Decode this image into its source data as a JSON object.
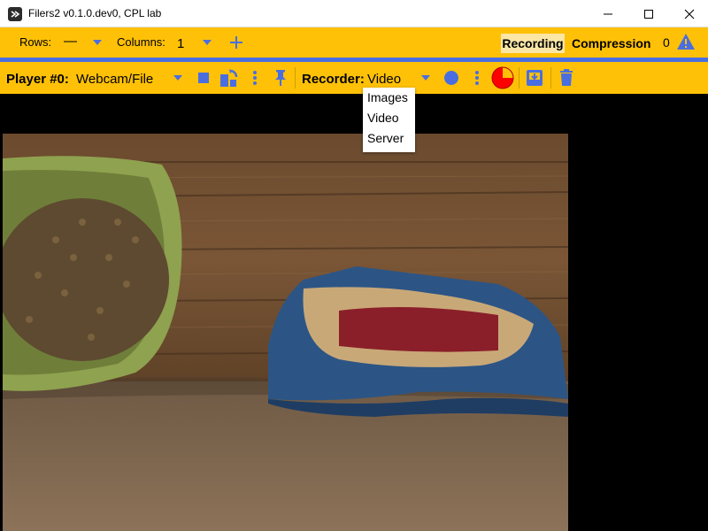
{
  "window": {
    "title": "Filers2 v0.1.0.dev0, CPL lab"
  },
  "top_toolbar": {
    "rows_label": "Rows:",
    "rows_value": "—",
    "columns_label": "Columns:",
    "columns_value": "1",
    "recording_tab": "Recording",
    "compression_tab": "Compression",
    "warning_count": "0"
  },
  "player_toolbar": {
    "player_label": "Player #0:",
    "player_source": "Webcam/File",
    "recorder_label": "Recorder:",
    "recorder_value": "Video"
  },
  "recorder_dropdown": {
    "options": [
      "Images",
      "Video",
      "Server"
    ]
  },
  "colors": {
    "toolbar": "#ffc107",
    "accent": "#4a6ee0",
    "record_red": "#ff0000"
  }
}
